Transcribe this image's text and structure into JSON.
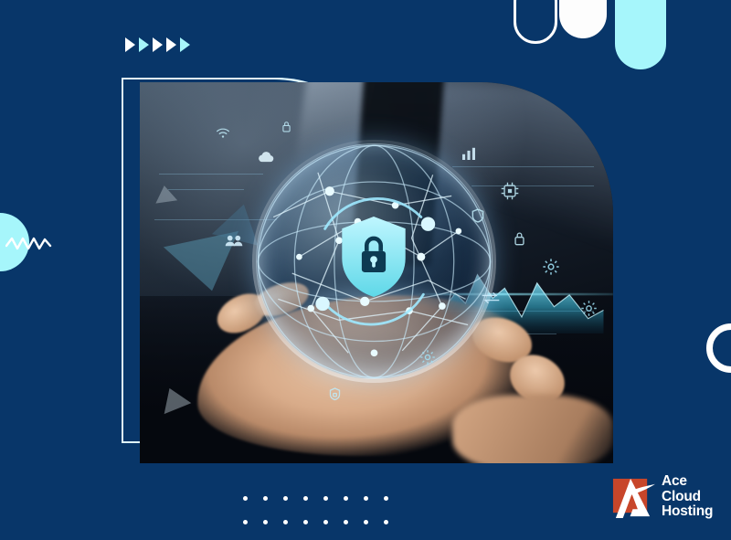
{
  "banner": {
    "background_color": "#083669",
    "accent_cyan": "#a6f6fb",
    "accent_white": "#ffffff",
    "brand_orange": "#c8462a"
  },
  "decorations": {
    "arrows": [
      {
        "name": "arrow-1",
        "color": "#ffffff"
      },
      {
        "name": "arrow-2",
        "color": "#a6f6fb"
      },
      {
        "name": "arrow-3",
        "color": "#ffffff"
      },
      {
        "name": "arrow-4",
        "color": "#ffffff"
      },
      {
        "name": "arrow-5",
        "color": "#a6f6fb"
      }
    ],
    "pills": [
      {
        "name": "pill-ring-outline",
        "style": "outline",
        "color": "#ffffff"
      },
      {
        "name": "pill-solid-white",
        "style": "solid",
        "color": "#fdfdfd"
      },
      {
        "name": "pill-solid-cyan",
        "style": "solid",
        "color": "#a6f6fb"
      }
    ],
    "left_circle": {
      "name": "cyan-circle",
      "color": "#a6f6fb"
    },
    "left_wave": {
      "name": "zigzag-wave",
      "color": "#ffffff"
    },
    "right_ring": {
      "name": "white-ring",
      "color": "#ffffff"
    },
    "dot_grid": {
      "columns": 8,
      "rows": 2,
      "color": "#ffffff"
    }
  },
  "photo": {
    "alt": "Businessman in dark suit holding a glowing digital globe with cybersecurity shield and lock",
    "frame_outline_color": "#dff6fb",
    "overlays": {
      "shield_lock": "shield-lock-icon",
      "globe": "network-globe",
      "mountain": "cyan-terrain-graphic",
      "hud_icons": [
        "cloud-icon",
        "gear-icon",
        "chip-icon",
        "lock-icon",
        "shield-icon",
        "users-icon",
        "chart-bars-icon",
        "transfer-arrows-icon",
        "wifi-icon",
        "database-icon"
      ]
    }
  },
  "logo": {
    "name": "ace-cloud-hosting-logo",
    "mark_background": "#c8462a",
    "mark_glyph": "A",
    "line1": "Ace",
    "line2": "Cloud",
    "line3": "Hosting",
    "text_color": "#ffffff"
  }
}
